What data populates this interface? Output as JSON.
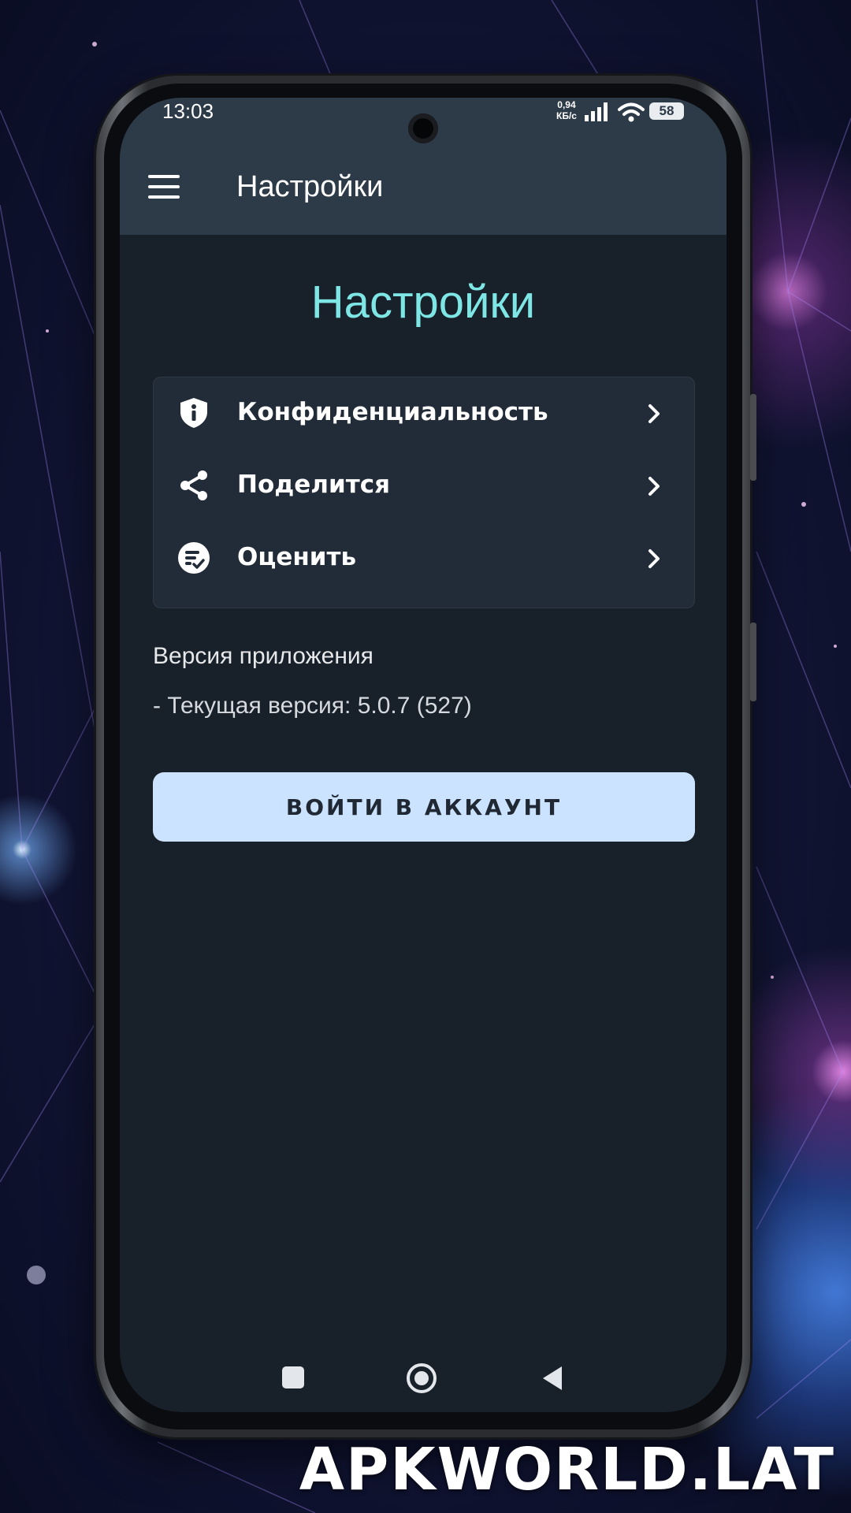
{
  "status_bar": {
    "time": "13:03",
    "net_speed_value": "0,94",
    "net_speed_unit": "КБ/с",
    "battery": "58"
  },
  "app_bar": {
    "title": "Настройки",
    "menu_icon": "hamburger-menu-icon"
  },
  "page": {
    "heading": "Настройки"
  },
  "settings_items": [
    {
      "label": "Конфиденциальность",
      "icon": "privacy-shield-icon"
    },
    {
      "label": "Поделится",
      "icon": "share-icon"
    },
    {
      "label": "Оценить",
      "icon": "rate-icon"
    }
  ],
  "version": {
    "label": "Версия приложения",
    "value": "- Текущая версия: 5.0.7 (527)"
  },
  "login_button": {
    "label": "ВОЙТИ В АККАУНТ"
  },
  "watermark": "APKWORLD.LAT",
  "colors": {
    "app_bar": "#2d3a48",
    "screen_bg": "#18202a",
    "card_bg": "#222c38",
    "heading": "#7ee7e5",
    "button_bg": "#cce3ff",
    "button_text": "#1f2833"
  }
}
